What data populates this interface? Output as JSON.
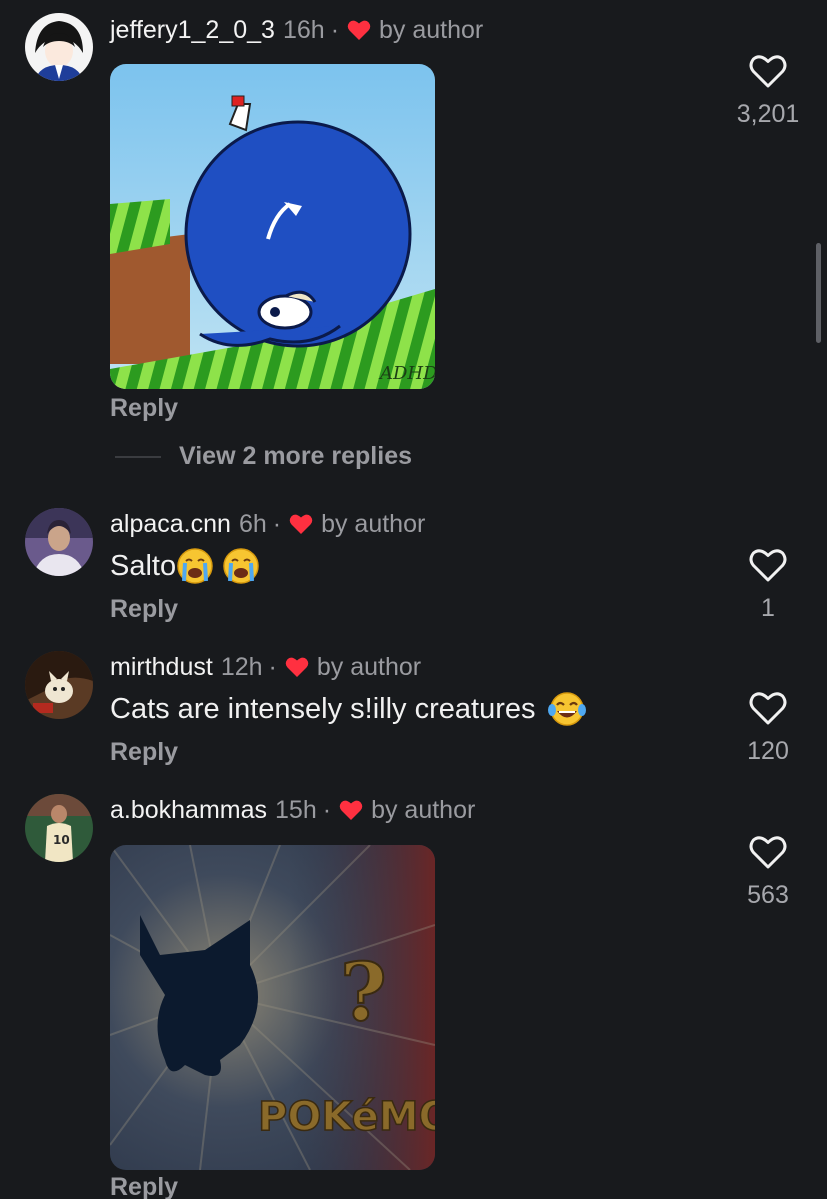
{
  "comments": [
    {
      "username": "jeffery1_2_0_3",
      "time": "16h",
      "separator": "·",
      "liked_by": "by author",
      "reply_label": "Reply",
      "likes": "3,201",
      "view_replies": "View 2 more replies",
      "media_watermark": "ADHD"
    },
    {
      "username": "alpaca.cnn",
      "time": "6h",
      "separator": "·",
      "liked_by": "by author",
      "text": "Salto",
      "emoji_icon": "loudly-crying-face",
      "reply_label": "Reply",
      "likes": "1"
    },
    {
      "username": "mirthdust",
      "time": "12h",
      "separator": "·",
      "liked_by": "by author",
      "text": "Cats are intensely s!illy creatures",
      "emoji_icon": "face-with-tears-of-joy",
      "reply_label": "Reply",
      "likes": "120"
    },
    {
      "username": "a.bokhammas",
      "time": "15h",
      "separator": "·",
      "liked_by": "by author",
      "reply_label": "Reply",
      "likes": "563",
      "media_text_1": "?",
      "media_text_2": "POKéMON"
    }
  ],
  "colors": {
    "background": "#181a1d",
    "heart_red": "#ff3040",
    "secondary_text": "#9a9ba0"
  }
}
